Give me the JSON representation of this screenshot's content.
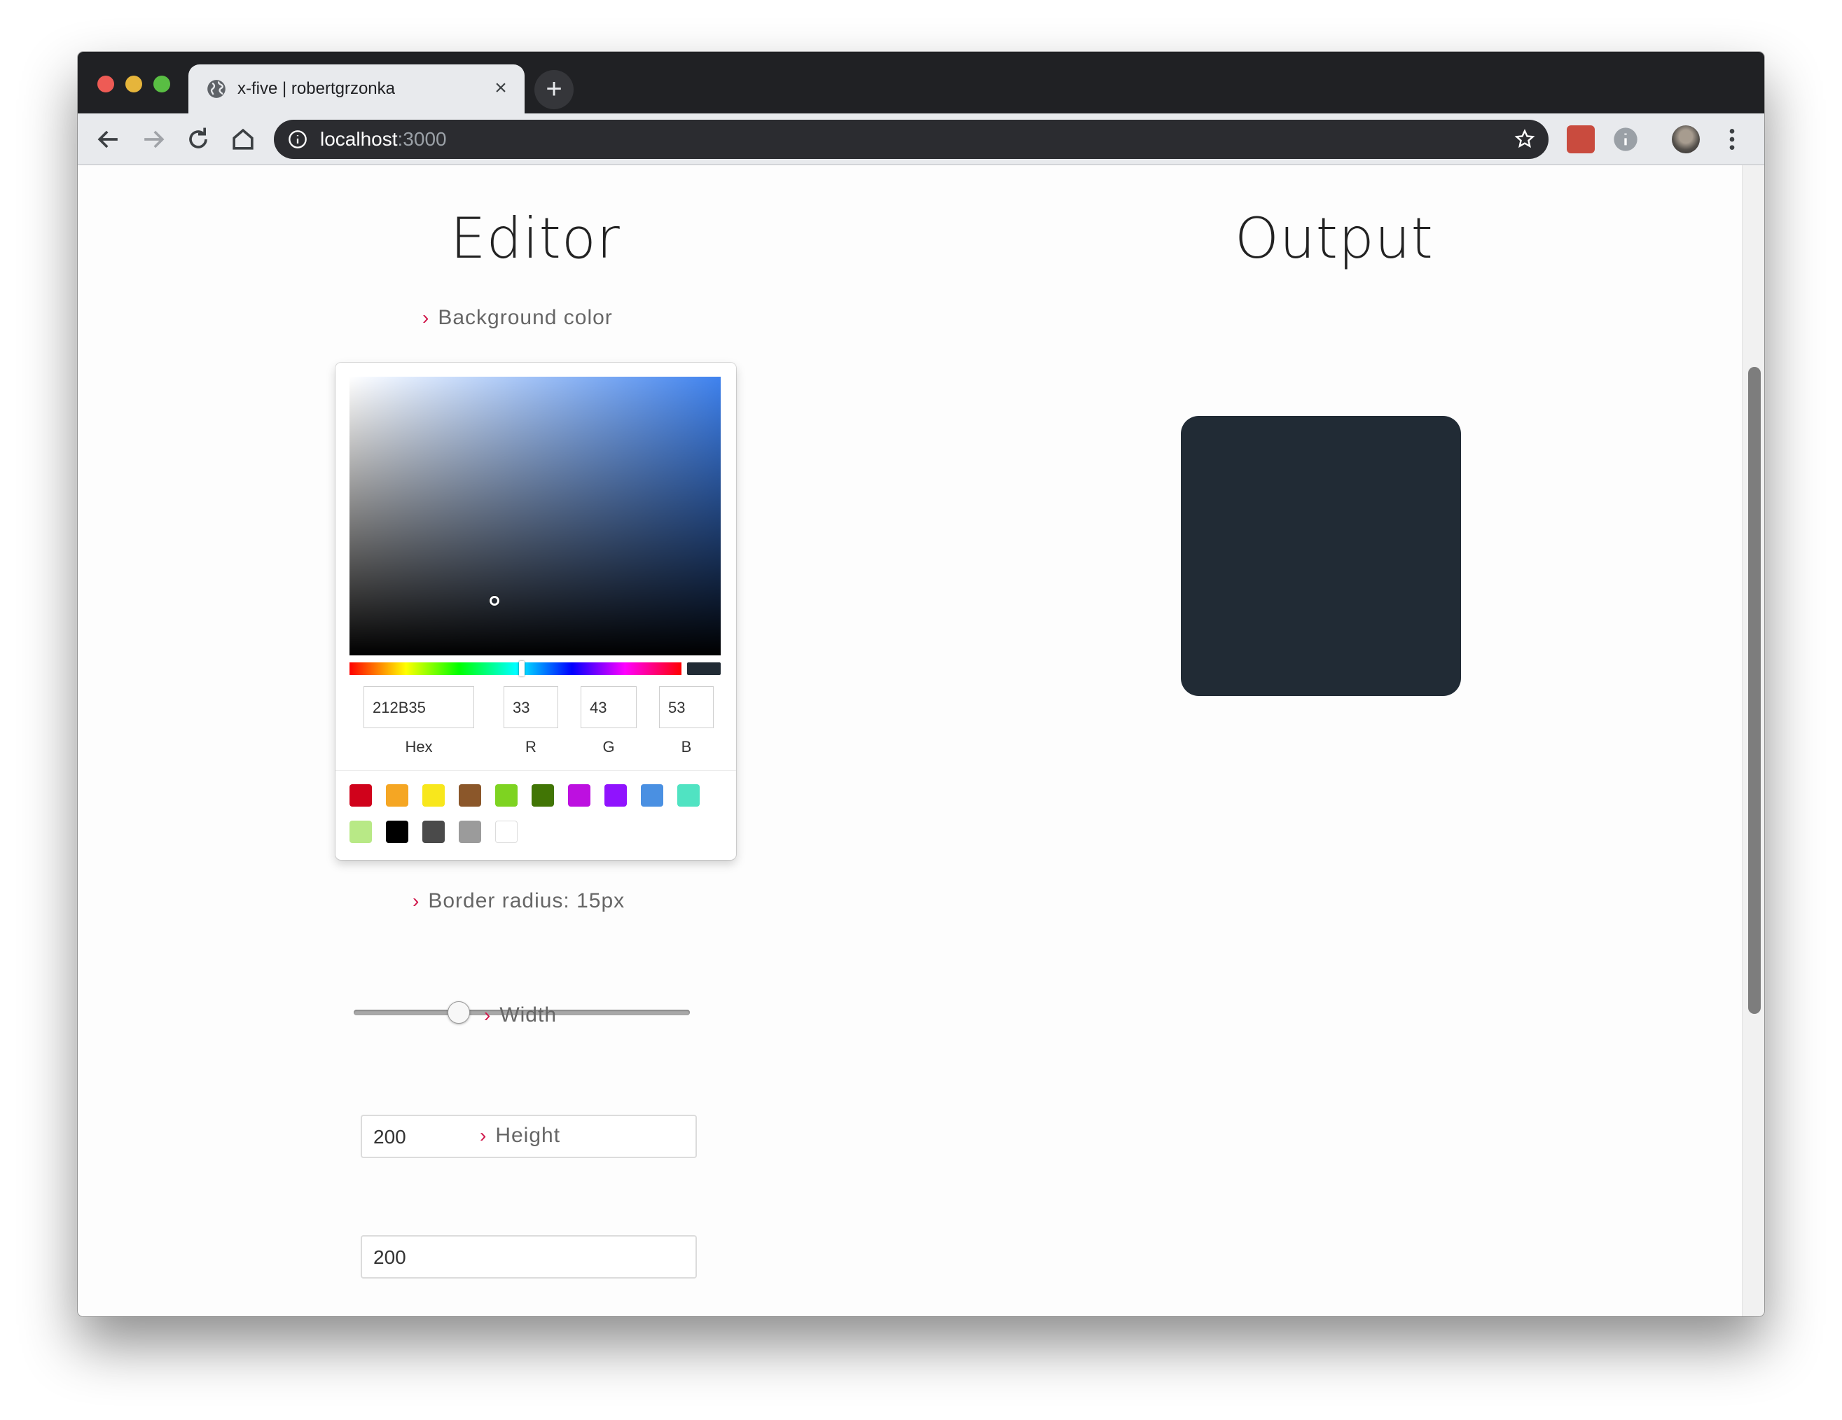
{
  "browser": {
    "tab_title": "x-five | robertgrzonka",
    "tab_close": "×",
    "new_tab": "+",
    "url_host": "localhost",
    "url_port": ":3000"
  },
  "editor": {
    "heading": "Editor",
    "chevron": "›",
    "background_color": {
      "label": "Background color",
      "value_hex": "#212B35",
      "hue_position_pct": 52,
      "picker": {
        "hex": "212B35",
        "r": "33",
        "g": "43",
        "b": "53",
        "hex_label": "Hex",
        "r_label": "R",
        "g_label": "G",
        "b_label": "B"
      },
      "swatches": [
        "#D0021B",
        "#F5A623",
        "#F8E71C",
        "#8B572A",
        "#7ED321",
        "#417505",
        "#BD10E0",
        "#9013FE",
        "#4A90E2",
        "#50E3C2",
        "#B8E986",
        "#000000",
        "#4A4A4A",
        "#9B9B9B",
        "#FFFFFF"
      ]
    },
    "border_radius": {
      "label": "Border radius: 15px",
      "value": 15,
      "min": 0,
      "max": 50
    },
    "width": {
      "label": "Width",
      "value": "200"
    },
    "height": {
      "label": "Height",
      "value": "200"
    }
  },
  "output": {
    "heading": "Output"
  }
}
